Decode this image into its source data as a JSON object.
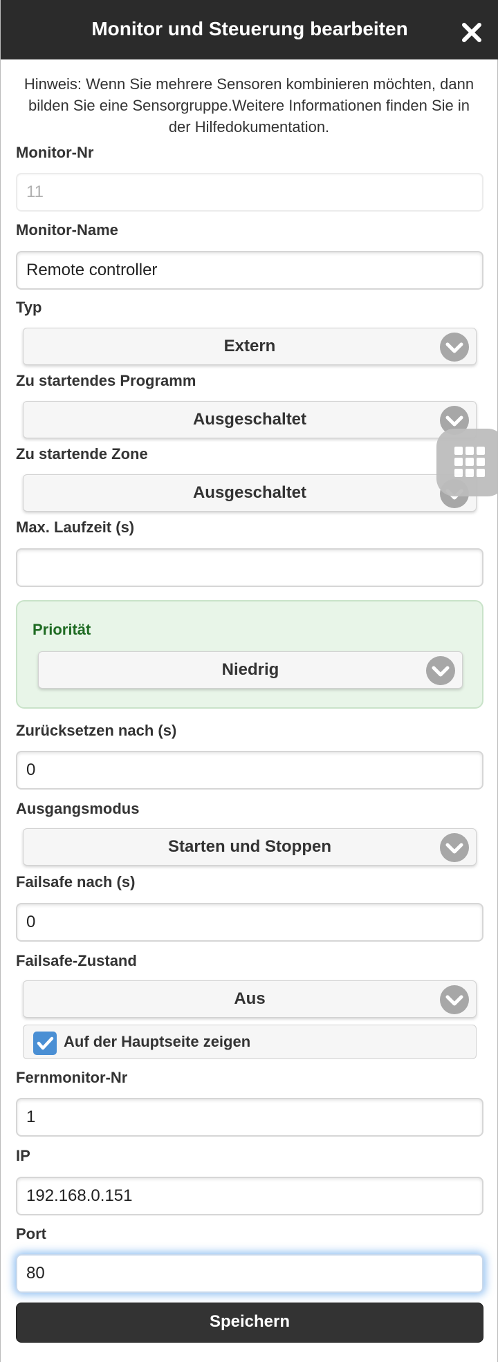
{
  "dialog": {
    "title": "Monitor und Steuerung bearbeiten",
    "hint": "Hinweis: Wenn Sie mehrere Sensoren kombinieren möchten, dann bilden Sie eine Sensorgruppe.Weitere Informationen finden Sie in der Hilfedokumentation."
  },
  "fields": {
    "monitor_nr": {
      "label": "Monitor-Nr",
      "value": "11"
    },
    "monitor_name": {
      "label": "Monitor-Name",
      "value": "Remote controller"
    },
    "typ": {
      "label": "Typ",
      "value": "Extern"
    },
    "programm": {
      "label": "Zu startendes Programm",
      "value": "Ausgeschaltet"
    },
    "zone": {
      "label": "Zu startende Zone",
      "value": "Ausgeschaltet"
    },
    "max_laufzeit": {
      "label": "Max. Laufzeit (s)",
      "value": ""
    },
    "prioritaet": {
      "label": "Priorität",
      "value": "Niedrig"
    },
    "zuruecksetzen": {
      "label": "Zurücksetzen nach (s)",
      "value": "0"
    },
    "ausgangsmodus": {
      "label": "Ausgangsmodus",
      "value": "Starten und Stoppen"
    },
    "failsafe_nach": {
      "label": "Failsafe nach (s)",
      "value": "0"
    },
    "failsafe_zustand": {
      "label": "Failsafe-Zustand",
      "value": "Aus"
    },
    "hauptseite": {
      "label": "Auf der Hauptseite zeigen",
      "checked": true
    },
    "fernmonitor_nr": {
      "label": "Fernmonitor-Nr",
      "value": "1"
    },
    "ip": {
      "label": "IP",
      "value": "192.168.0.151"
    },
    "port": {
      "label": "Port",
      "value": "80"
    }
  },
  "buttons": {
    "save": "Speichern"
  },
  "icons": {
    "close": "close-icon",
    "chevron": "chevron-down-icon",
    "check": "checkmark-icon",
    "grid": "grid-menu-icon"
  },
  "colors": {
    "header_bg": "#2b2b2b",
    "priority_bg": "#e8f5e8",
    "priority_text": "#1f6b23",
    "checkbox": "#4a8fd4",
    "focus_glow": "#388ce6",
    "save_bg": "#333333"
  }
}
